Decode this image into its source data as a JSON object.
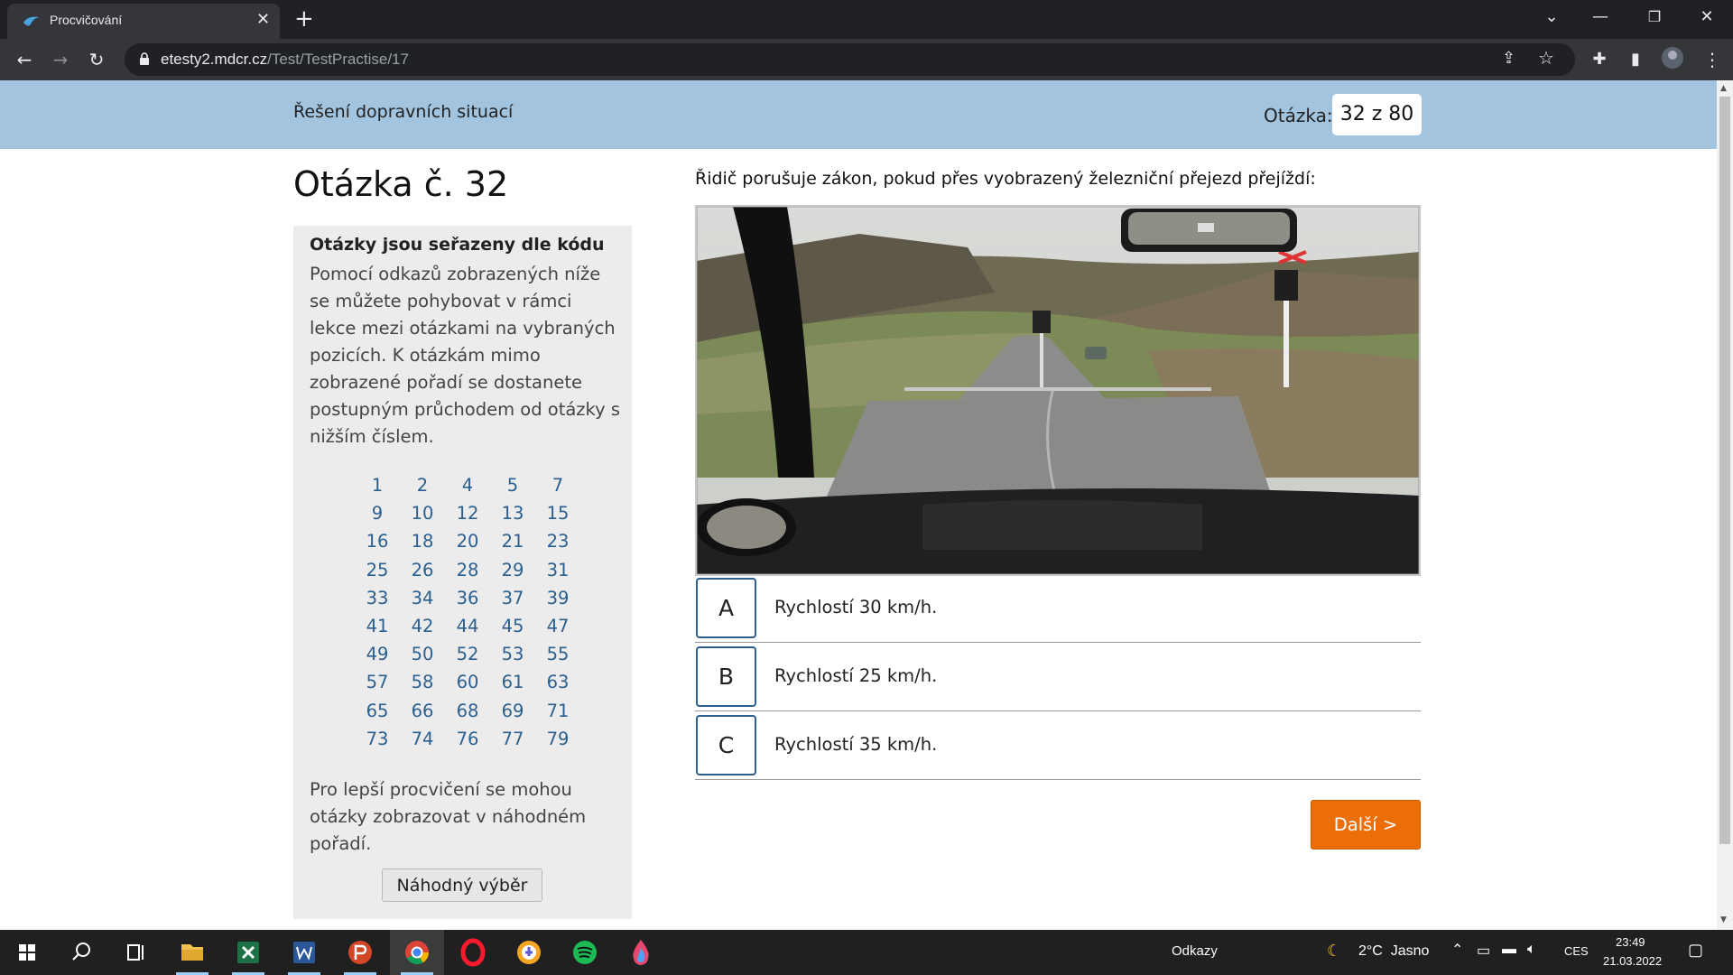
{
  "browser": {
    "tab_title": "Procvičování",
    "url_host": "etesty2.mdcr.cz",
    "url_path": "/Test/TestPractise/17"
  },
  "header": {
    "title": "Řešení dopravních situací",
    "counter_label": "Otázka:",
    "counter_value": "32 z 80"
  },
  "question": {
    "heading": "Otázka č. 32",
    "text": "Řidič porušuje zákon, pokud přes vyobrazený železniční přejezd přejíždí:"
  },
  "sidebar": {
    "heading": "Otázky jsou seřazeny dle kódu",
    "description": "Pomocí odkazů zobrazených níže se můžete pohybovat v rámci lekce mezi otázkami na vybraných pozicích. K otázkám mimo zobrazené pořadí se dostanete postupným průchodem od otázky s nižším číslem.",
    "question_numbers": [
      "1",
      "2",
      "4",
      "5",
      "7",
      "9",
      "10",
      "12",
      "13",
      "15",
      "16",
      "18",
      "20",
      "21",
      "23",
      "25",
      "26",
      "28",
      "29",
      "31",
      "33",
      "34",
      "36",
      "37",
      "39",
      "41",
      "42",
      "44",
      "45",
      "47",
      "49",
      "50",
      "52",
      "53",
      "55",
      "57",
      "58",
      "60",
      "61",
      "63",
      "65",
      "66",
      "68",
      "69",
      "71",
      "73",
      "74",
      "76",
      "77",
      "79"
    ],
    "random_text": "Pro lepší procvičení se mohou otázky zobrazovat v náhodném pořadí.",
    "random_button": "Náhodný výběr"
  },
  "answers": [
    {
      "letter": "A",
      "text": "Rychlostí 30 km/h."
    },
    {
      "letter": "B",
      "text": "Rychlostí 25 km/h."
    },
    {
      "letter": "C",
      "text": "Rychlostí 35 km/h."
    }
  ],
  "next_button": "Další >",
  "taskbar": {
    "links_label": "Odkazy",
    "weather": "2°C  Jasno",
    "language": "CES",
    "time": "23:49",
    "date": "21.03.2022"
  },
  "colors": {
    "header_band": "#a2c4df",
    "link": "#2a5f8f",
    "next_button": "#ec6e08"
  }
}
